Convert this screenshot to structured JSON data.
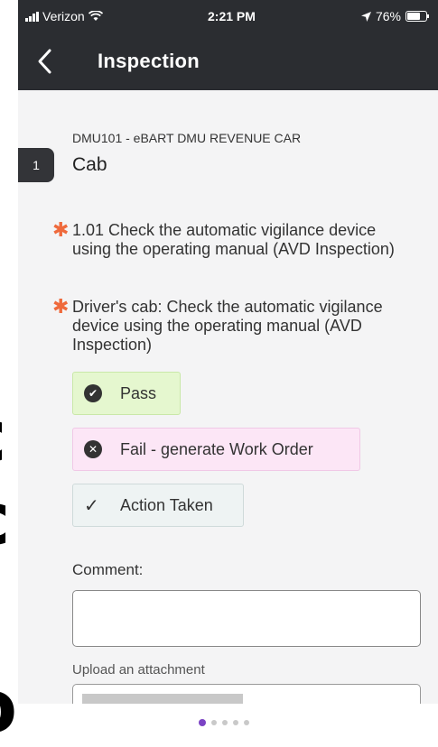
{
  "status_bar": {
    "carrier": "Verizon",
    "time": "2:21 PM",
    "battery": "76%",
    "battery_level": 0.76
  },
  "header": {
    "title": "Inspection"
  },
  "section": {
    "subtitle": "DMU101 - eBART DMU REVENUE CAR",
    "number": "1",
    "title": "Cab"
  },
  "questions": [
    {
      "text": "1.01 Check the automatic vigilance device using the operating manual (AVD Inspection)"
    },
    {
      "text": "Driver's cab: Check the automatic vigilance device using the operating manual (AVD Inspection)"
    }
  ],
  "options": {
    "pass": "Pass",
    "fail": "Fail - generate Work Order",
    "action": "Action Taken"
  },
  "comment": {
    "label": "Comment:",
    "value": ""
  },
  "upload": {
    "label": "Upload an attachment"
  },
  "pager": {
    "page_count": 5,
    "active": 1
  },
  "colors": {
    "header_bg": "#2b2d31",
    "required_star": "#ef6a3c",
    "pass_bg": "#e5f7cf",
    "fail_bg": "#fce6f6",
    "pager_active": "#7b43c4"
  }
}
